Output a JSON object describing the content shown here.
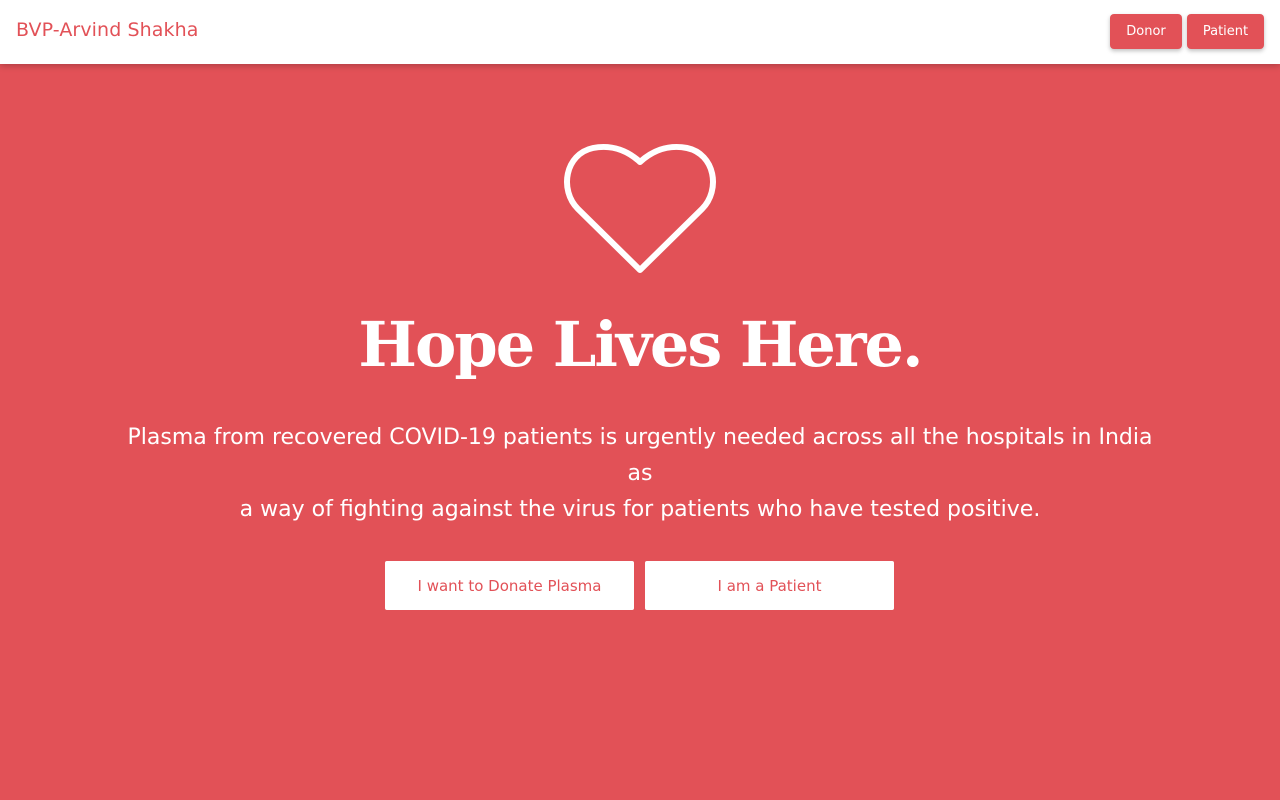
{
  "navbar": {
    "brand": "BVP-Arvind Shakha",
    "donor_button": "Donor",
    "patient_button": "Patient"
  },
  "hero": {
    "icon": "heart-outline-icon",
    "headline": "Hope Lives Here.",
    "description_lines": [
      "Plasma from recovered COVID-19 patients is urgently needed across all the hospitals in India",
      "as",
      "a way of fighting against the virus for patients who have tested positive."
    ],
    "donate_button": "I want to Donate Plasma",
    "patient_button": "I am a Patient"
  },
  "colors": {
    "brand_red": "#e25157",
    "white": "#ffffff"
  }
}
